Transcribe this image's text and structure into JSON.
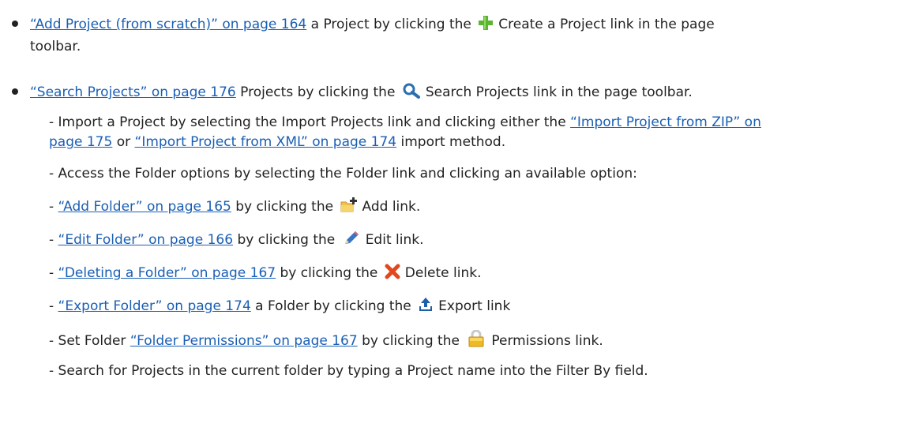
{
  "items": {
    "add_project": {
      "link": "“Add Project (from scratch)” on page 164",
      "text_before_icon": "a Project by clicking the",
      "icon": "green-plus-icon",
      "text_after_icon": "Create a Project link in the page",
      "continuation": "toolbar."
    },
    "search_projects": {
      "link": "“Search Projects” on page 176",
      "text_before_icon": "Projects by clicking the",
      "icon": "magnifier-icon",
      "text_after_icon": "Search Projects link in the page toolbar."
    }
  },
  "subitems": {
    "import": {
      "prefix": "- Import a Project by selecting the Import Projects link and clicking either the",
      "link_zip": "“Import Project from ZIP” on",
      "link_zip_cont": "page 175",
      "or_text": "or",
      "link_xml": "“Import Project from XML” on page 174",
      "suffix": "import method."
    },
    "access": {
      "text": "- Access the Folder options by selecting the Folder link and clicking an available option:"
    },
    "add_folder": {
      "dash": "-",
      "link": "“Add Folder” on page 165",
      "text_before_icon": "by clicking the",
      "icon": "folder-add-icon",
      "text_after_icon": "Add link."
    },
    "edit_folder": {
      "dash": "-",
      "link": "“Edit Folder” on page 166",
      "text_before_icon": "by clicking the",
      "icon": "pencil-icon",
      "text_after_icon": "Edit link."
    },
    "delete_folder": {
      "dash": "-",
      "link": "“Deleting a Folder” on page 167",
      "text_before_icon": "by clicking the",
      "icon": "red-x-icon",
      "text_after_icon": "Delete link."
    },
    "export_folder": {
      "dash": "-",
      "link": "“Export Folder” on page 174",
      "text_before_icon": "a Folder by clicking the",
      "icon": "export-icon",
      "text_after_icon": "Export link"
    },
    "permissions": {
      "prefix": "- Set Folder",
      "link": "“Folder Permissions” on page 167",
      "text_before_icon": "by clicking the",
      "icon": "padlock-icon",
      "text_after_icon": "Permissions link."
    },
    "search": {
      "text": "- Search for Projects in the current folder by typing a Project name into the Filter By field."
    }
  },
  "colors": {
    "link": "#1a5fb4",
    "text": "#222222"
  }
}
